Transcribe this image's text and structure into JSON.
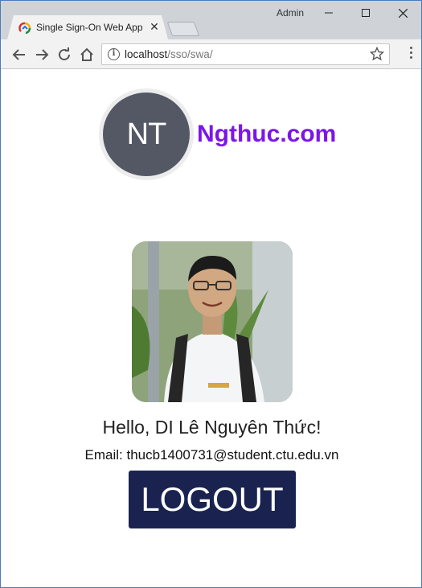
{
  "window": {
    "user_label": "Admin",
    "controls": {
      "minimize_icon": "minimize-icon",
      "maximize_icon": "maximize-icon",
      "close_icon": "close-icon"
    }
  },
  "tab": {
    "title": "Single Sign-On Web App",
    "close_label": "✕",
    "favicon": "app-favicon-icon"
  },
  "toolbar": {
    "url_host": "localhost",
    "url_path": "/sso/swa/",
    "info_glyph": "i"
  },
  "page": {
    "logo_initials": "NT",
    "brand_name": "Ngthuc.com",
    "greeting": "Hello, DI Lê Nguyên Thức!",
    "email": "Email: thucb1400731@student.ctu.edu.vn",
    "logout_label": "LOGOUT"
  },
  "colors": {
    "brand": "#7b16e8",
    "logout_bg": "#1a234f",
    "logo_circle": "#545865"
  }
}
